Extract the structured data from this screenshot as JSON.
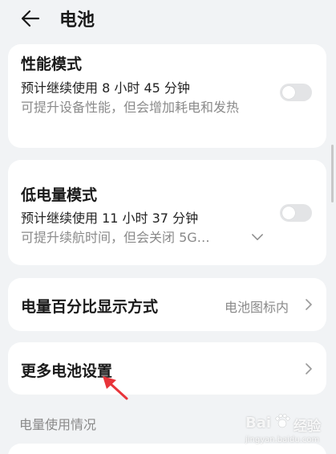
{
  "header": {
    "title": "电池"
  },
  "performance_mode": {
    "title": "性能模式",
    "estimate": "预计继续使用 8 小时 45 分钟",
    "description": "可提升设备性能，但会增加耗电和发热",
    "enabled": false
  },
  "low_power_mode": {
    "title": "低电量模式",
    "estimate": "预计继续使用 11 小时 37 分钟",
    "description": "可提升续航时间，但会关闭 5G…",
    "enabled": false
  },
  "battery_percentage": {
    "label": "电量百分比显示方式",
    "value": "电池图标内"
  },
  "more_settings": {
    "label": "更多电池设置"
  },
  "usage_section": {
    "label": "电量使用情况"
  },
  "watermark": {
    "brand": "Bai",
    "suffix": "经验",
    "domain": "jingyan.baidu.com"
  },
  "colors": {
    "background": "#f1f3f5",
    "card": "#ffffff",
    "toggle_off": "#e3e4e6",
    "annotation_arrow": "#e8343a"
  },
  "icons": {
    "back": "back-arrow-icon",
    "expand": "chevron-down-icon",
    "navigate": "chevron-right-icon"
  }
}
